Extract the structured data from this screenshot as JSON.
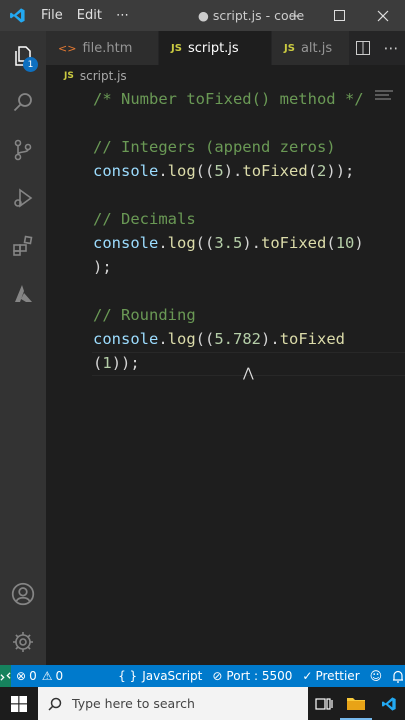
{
  "titlebar": {
    "menu": [
      "File",
      "Edit",
      "⋯"
    ],
    "title": "● script.js - code"
  },
  "activity": {
    "explorer_badge": "1"
  },
  "tabs": [
    {
      "label": "file.htm",
      "icon": "html-file-icon",
      "active": false
    },
    {
      "label": "script.js",
      "icon": "js-file-icon",
      "active": true,
      "modified": true
    },
    {
      "label": "alt.js",
      "icon": "js-file-icon",
      "active": false
    }
  ],
  "breadcrumb": {
    "icon_text": "JS",
    "file": "script.js"
  },
  "code": {
    "line1": "/* Number toFixed() method */",
    "line3": "// Integers (append zeros)",
    "line4_obj": "console",
    "line4_fn": "log",
    "line4_num1": "5",
    "line4_fn2": "toFixed",
    "line4_num2": "2",
    "line6": "// Decimals",
    "line7_obj": "console",
    "line7_fn": "log",
    "line7_num1": "3.5",
    "line7_fn2": "toFixed",
    "line7_num2": "10",
    "line8": ");",
    "line10": "// Rounding",
    "line11_obj": "console",
    "line11_fn": "log",
    "line11_num1": "5.782",
    "line11_fn2": "toFixed",
    "line12_num": "1",
    "line12_tail": "));"
  },
  "statusbar": {
    "errors": "0",
    "warnings": "0",
    "language": "JavaScript",
    "port": "Port : 5500",
    "prettier": "Prettier"
  },
  "taskbar": {
    "search_placeholder": "Type here to search"
  },
  "colors": {
    "accent": "#007acc",
    "comment": "#6a9955",
    "variable": "#9cdcfe",
    "function": "#dcdcaa",
    "number": "#b5cea8"
  }
}
